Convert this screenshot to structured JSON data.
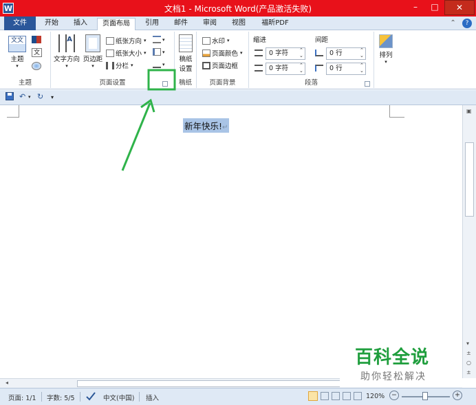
{
  "window": {
    "app_icon": "W",
    "title": "文档1 - Microsoft Word(产品激活失败)",
    "minimize": "–",
    "maximize": "□",
    "close": "✕"
  },
  "tabs": {
    "file": "文件",
    "items": [
      "开始",
      "插入",
      "页面布局",
      "引用",
      "邮件",
      "审阅",
      "视图",
      "福昕PDF"
    ],
    "active_index": 2,
    "collapse": "⌃",
    "help": "?"
  },
  "ribbon": {
    "theme_group": {
      "theme_button": "主题",
      "label": "主题",
      "theme_icon_text": "文文",
      "fonts_icon_text": "文"
    },
    "page_setup_group": {
      "text_direction": "文字方向",
      "margins": "页边距",
      "orientation": "纸张方向",
      "size": "纸张大小",
      "columns": "分栏",
      "label": "页面设置"
    },
    "manuscript_group": {
      "button_line1": "稿纸",
      "button_line2": "设置",
      "label": "稿纸"
    },
    "page_background_group": {
      "watermark": "水印",
      "page_color": "页面颜色",
      "page_borders": "页面边框",
      "label": "页面背景"
    },
    "paragraph_group": {
      "indent_title": "缩进",
      "spacing_title": "间距",
      "indent_left": "0 字符",
      "indent_right": "0 字符",
      "spacing_before": "0 行",
      "spacing_after": "0 行",
      "label": "段落"
    },
    "arrange_group": {
      "arrange": "排列"
    }
  },
  "document": {
    "text": "新年快乐!",
    "paragraph_mark": "↵"
  },
  "statusbar": {
    "page": "页面: 1/1",
    "words": "字数: 5/5",
    "language": "中文(中国)",
    "mode": "插入",
    "zoom": "120%",
    "zoom_minus": "−",
    "zoom_plus": "+"
  },
  "watermark": {
    "brand": "百科全说",
    "tagline": "助你轻松解决"
  },
  "colors": {
    "titlebar": "#e8111a",
    "file_tab": "#2b579a",
    "annotation": "#2fb34a",
    "selection": "#a9c4e6"
  }
}
